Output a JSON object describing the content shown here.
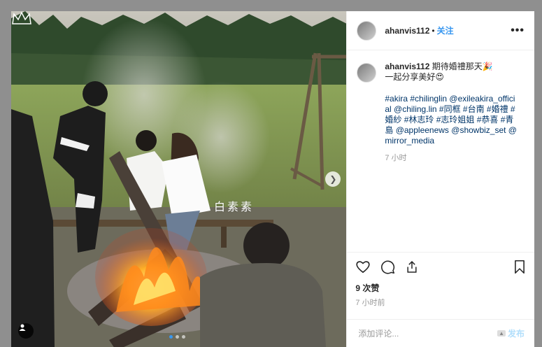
{
  "post": {
    "username": "ahanvis112",
    "separator": "•",
    "follow_label": "关注",
    "more_label": "•••",
    "caption_text": "期待婚禮那天🎉",
    "caption_line2": "一起分享美好😍",
    "hashtags": "#akira #chilinglin @exileakira_official @chiling.lin #同框 #台南 #婚禮 #婚紗 #林志玲 #志玲姐姐 #恭喜 #青島 @appleenews @showbiz_set @mirror_media",
    "comment_time": "7 小时",
    "likes": "9 次赞",
    "posted_ago": "7 小时前"
  },
  "photo": {
    "watermark": "白素素",
    "carousel_dots": 3,
    "active_dot": 1
  },
  "comment_input": {
    "placeholder": "添加评论...",
    "publish_label": "发布"
  },
  "icons": {
    "like": "heart-icon",
    "comment": "comment-icon",
    "share": "share-icon",
    "save": "bookmark-icon",
    "next": "chevron-right-icon",
    "tag": "user-tag-icon"
  }
}
